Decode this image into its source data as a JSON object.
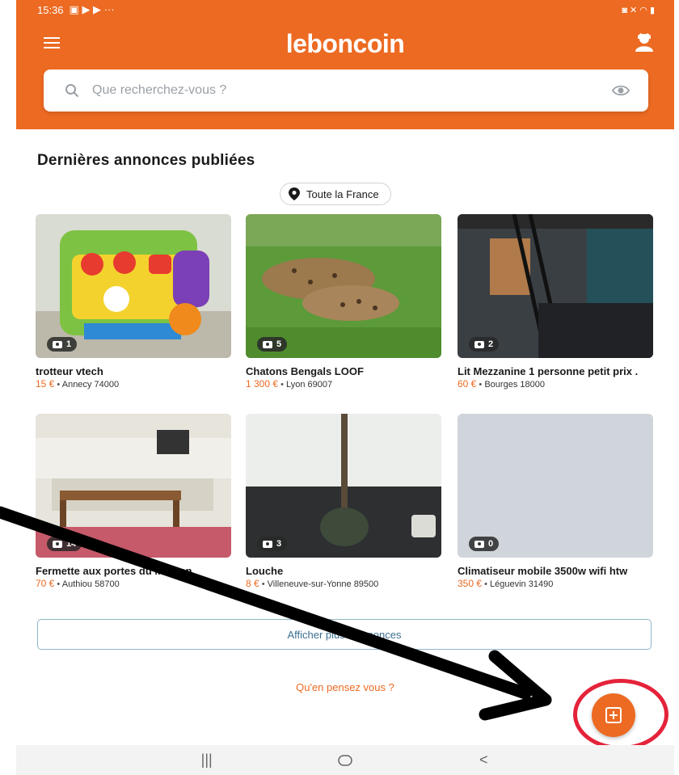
{
  "status_bar": {
    "time": "15:36"
  },
  "header": {
    "app_name": "leboncoin"
  },
  "search": {
    "placeholder": "Que recherchez-vous ?"
  },
  "section": {
    "title": "Dernières annonces publiées",
    "location_filter": "Toute la France"
  },
  "listings": [
    {
      "title": "trotteur vtech",
      "price": "15 €",
      "location": "Annecy 74000",
      "photo_count": "1"
    },
    {
      "title": "Chatons Bengals LOOF",
      "price": "1 300 €",
      "location": "Lyon 69007",
      "photo_count": "5"
    },
    {
      "title": "Lit Mezzanine 1 personne petit prix .",
      "price": "60 €",
      "location": "Bourges 18000",
      "photo_count": "2"
    },
    {
      "title": "Fermette aux portes du Morvan",
      "price": "70 €",
      "location": "Authiou 58700",
      "photo_count": "14"
    },
    {
      "title": "Louche",
      "price": "8 €",
      "location": "Villeneuve-sur-Yonne 89500",
      "photo_count": "3"
    },
    {
      "title": "Climatiseur mobile 3500w wifi htw",
      "price": "350 €",
      "location": "Léguevin 31490",
      "photo_count": "0"
    }
  ],
  "actions": {
    "show_more": "Afficher plus d'annonces",
    "feedback": "Qu'en pensez vous ?"
  },
  "icons": {
    "menu": "menu-icon",
    "profile": "profile-icon",
    "search": "search-icon",
    "saved_searches": "eye-icon",
    "location": "location-pin-icon",
    "camera": "camera-icon",
    "post_ad": "add-ad-icon",
    "nav_recent": "recent-apps-icon",
    "nav_home": "home-icon",
    "nav_back": "back-icon"
  },
  "colors": {
    "brand": "#ec6a22",
    "annotation_ring": "#e4233a",
    "link": "#3a6f8f"
  }
}
